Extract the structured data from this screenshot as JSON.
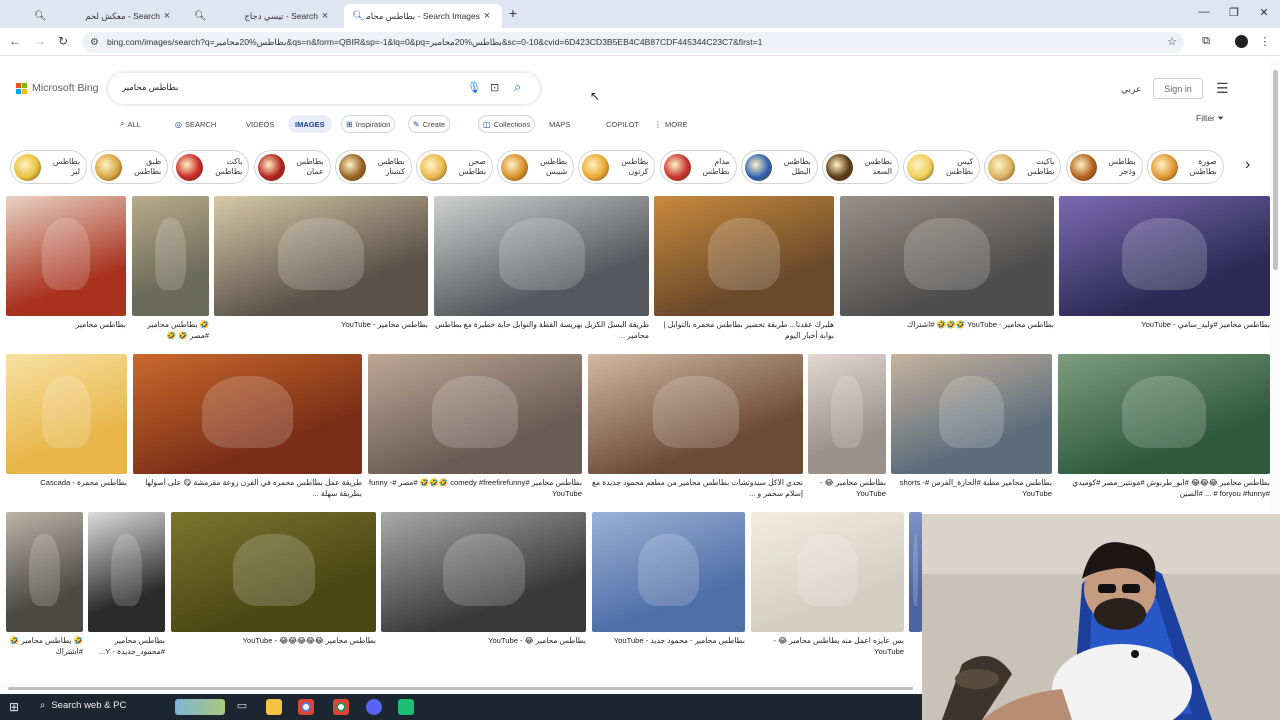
{
  "browser": {
    "tabs": [
      {
        "title": "Search - معكش لحم",
        "active": false
      },
      {
        "title": "Search - تيسي دجاج",
        "active": false
      },
      {
        "title": "Search Images - بطاطس محامير",
        "active": true
      }
    ],
    "new_tab": "+",
    "window_controls": {
      "minimize": "—",
      "restore": "❐",
      "close": "✕"
    },
    "url": "bing.com/images/search?q=بطاطس%20محامير&qs=n&form=QBIR&sp=-1&lq=0&pq=بطاطس%20محامير&sc=0-10&cvid=6D423CD3B5EB4C4B87CDF445344C23C7&first=1"
  },
  "bing": {
    "brand": "Microsoft Bing",
    "brand_colors": [
      "#f25022",
      "#7fba00",
      "#00a4ef",
      "#ffb900"
    ],
    "query": "بطاطس محامير",
    "lang_link": "عربي",
    "sign_in": "Sign in",
    "filter": "Filter",
    "scopes": [
      {
        "label": "ALL",
        "icon": "search-icon"
      },
      {
        "label": "SEARCH",
        "icon": "copilot-icon"
      },
      {
        "label": "VIDEOS",
        "icon": ""
      },
      {
        "label": "IMAGES",
        "icon": "",
        "active": true
      },
      {
        "label": "Inspiration",
        "icon": "inspiration-icon",
        "pill": true
      },
      {
        "label": "Create",
        "icon": "create-icon",
        "pill": true
      },
      {
        "label": "Collections",
        "icon": "collections-icon",
        "pill": true
      },
      {
        "label": "MAPS",
        "icon": ""
      },
      {
        "label": "COPILOT",
        "icon": ""
      },
      {
        "label": "MORE",
        "icon": "more-icon"
      }
    ],
    "chips": [
      {
        "label": "بطاطس ليز",
        "color": "#e9c13a"
      },
      {
        "label": "طبق بطاطس",
        "color": "#d9a441"
      },
      {
        "label": "باكت بطاطس",
        "color": "#c8282a"
      },
      {
        "label": "بطاطس عمان",
        "color": "#b3201d"
      },
      {
        "label": "بطاطس كشنار",
        "color": "#9a6327"
      },
      {
        "label": "صحن بطاطس",
        "color": "#e7b84c"
      },
      {
        "label": "بطاطس شيبس",
        "color": "#d88f2a"
      },
      {
        "label": "بطاطس كرتون",
        "color": "#e9a830"
      },
      {
        "label": "مدام بطاطس",
        "color": "#c7342e"
      },
      {
        "label": "بطاطس البطل",
        "color": "#2f62b3"
      },
      {
        "label": "بطاطس السعد",
        "color": "#5a3a18"
      },
      {
        "label": "كيس بطاطس",
        "color": "#efcf5a"
      },
      {
        "label": "باكيت بطاطس",
        "color": "#d8b35e"
      },
      {
        "label": "بطاطس ودجز",
        "color": "#b4611e"
      },
      {
        "label": "صورة بطاطس",
        "color": "#e0962f"
      }
    ],
    "rows": [
      [
        {
          "caption": "بطاطس محامير",
          "colors": [
            "#a9321f",
            "#e8d3c4"
          ]
        },
        {
          "caption": "🤣 بطاطس محامير #مصر 🤣 🤣",
          "colors": [
            "#6a6b58",
            "#bcaa8c"
          ]
        },
        {
          "caption": "بطاطس محامير - YouTube",
          "colors": [
            "#5a5148",
            "#d9c9a8"
          ]
        },
        {
          "caption": "طريقة البسل الكريل بهريسة القطة والتوابل حابة خطيرة مع بطاطس محامير ...",
          "colors": [
            "#55585c",
            "#cfd1d0"
          ]
        },
        {
          "caption": "هلبرك عقدنا... طريقة تحضير بطاطس محمره بالتوابل | بوابة أخبار اليوم",
          "colors": [
            "#6b4a2a",
            "#c88a3e"
          ]
        },
        {
          "caption": "بطاطس محامير - YouTube 🤣🤣🤣 #اشتراك",
          "colors": [
            "#4e4e4e",
            "#9a9089"
          ]
        },
        {
          "caption": "بطاطس محامير #وليد_سامي - YouTube",
          "colors": [
            "#2d2b55",
            "#7b6ab2"
          ]
        }
      ],
      [
        {
          "caption": "بطاطس محمرة - Cascada",
          "colors": [
            "#e8b64a",
            "#f7e1a2"
          ]
        },
        {
          "caption": "طريقة عمل بطاطس محمره في الفرن روعة مقرمشة 😋 على أصولها بطريقة سهلة ...",
          "colors": [
            "#7b2e17",
            "#c9692c"
          ]
        },
        {
          "caption": "بطاطس محامير #comedy #freefirefunny 🤣🤣🤣 #مصر #funny - YouTube",
          "colors": [
            "#6a5b54",
            "#bfa794"
          ]
        },
        {
          "caption": "تحدي الاكل سندوتشات بطاطس محامير من مطعم محمود جديدة مع إسلام سحمر و ...",
          "colors": [
            "#6c4a36",
            "#d3b9a3"
          ]
        },
        {
          "caption": "بطاطس محامير 😂 - YouTube",
          "colors": [
            "#9a928b",
            "#e1d8d0"
          ]
        },
        {
          "caption": "بطاطس محامير مظبة #الحارة_الفرس #shorts - YouTube",
          "colors": [
            "#5d6d7d",
            "#c6b39c"
          ]
        },
        {
          "caption": "بطاطس محامير 😂😂😂 #ابو_طربوش #مونتير_مصر #كوميدي #foryou #funny # ... #الصين",
          "colors": [
            "#2f5a3c",
            "#7c9d7e"
          ]
        }
      ],
      [
        {
          "caption": "🤣 بطاطس محامير 🤣 #اشتراك",
          "colors": [
            "#4b4a44",
            "#bdb4a8"
          ]
        },
        {
          "caption": "بطاطس محامير #محمود_جديدة - Y...",
          "colors": [
            "#2b2b2b",
            "#dcdcdc"
          ]
        },
        {
          "caption": "بطاطس محامير 😂😂😂😂😂 - YouTube",
          "colors": [
            "#4b4713",
            "#7b7530"
          ]
        },
        {
          "caption": "بطاطس محامير 😂 - YouTube",
          "colors": [
            "#3a3a3a",
            "#a9a9a9"
          ]
        },
        {
          "caption": "بطاطس محامير - محمود جديد - YouTube",
          "colors": [
            "#4f6fa8",
            "#9bb2d6"
          ]
        },
        {
          "caption": "بس عايزه اعمل منه بطاطس محامير 😂 - YouTube",
          "colors": [
            "#d4cfc3",
            "#f2ece1"
          ]
        },
        {
          "caption": "",
          "colors": [
            "#4a66a0",
            "#7e96c3"
          ]
        }
      ]
    ]
  },
  "taskbar": {
    "search": "Search web & PC"
  }
}
